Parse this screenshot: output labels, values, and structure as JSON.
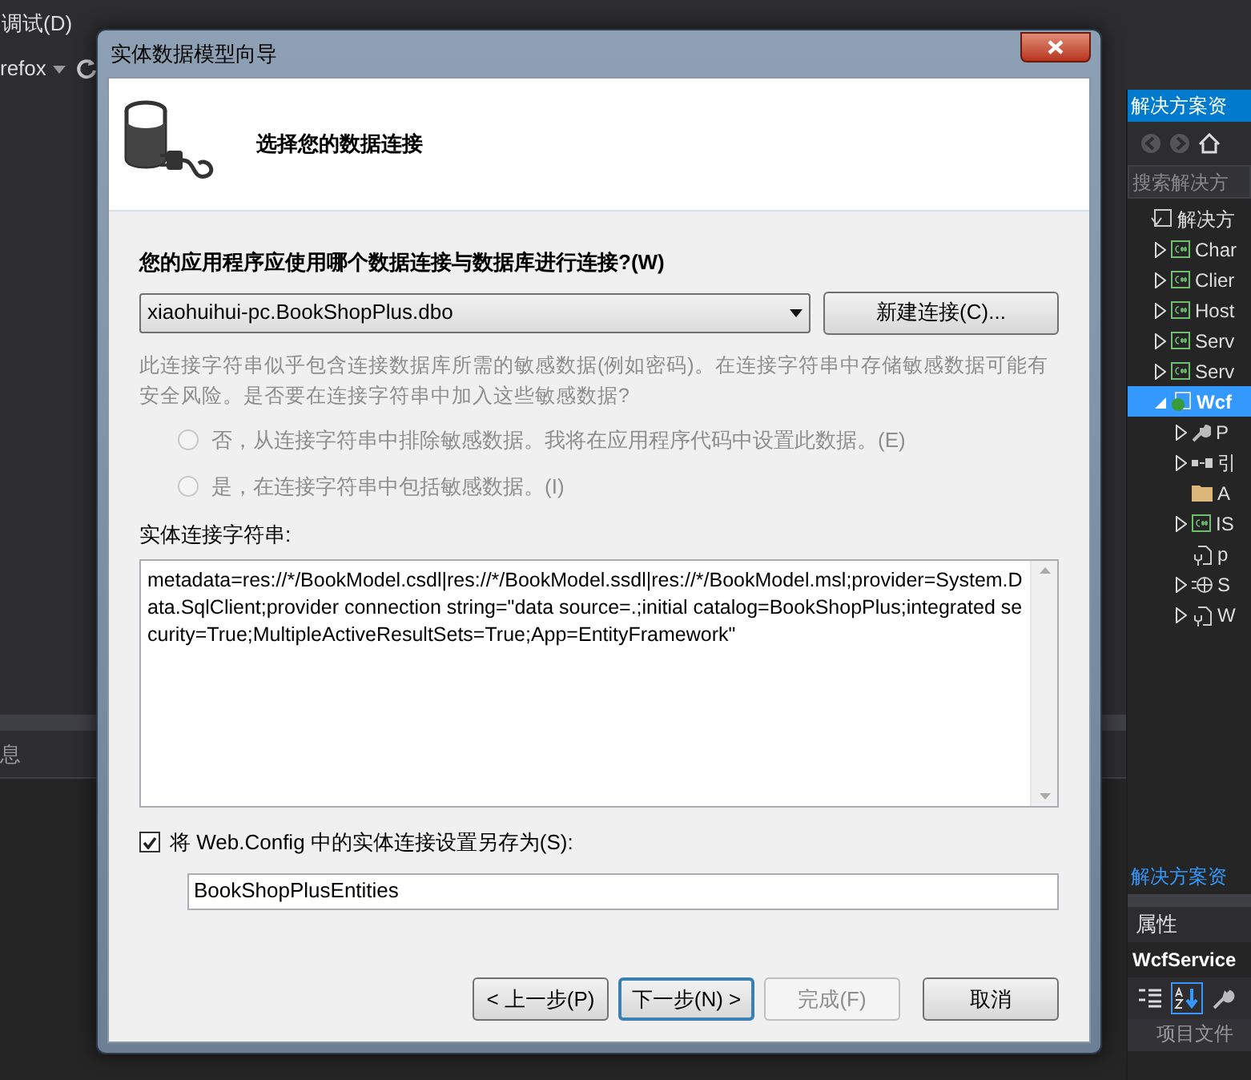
{
  "menu_bar": [
    "调试(D)"
  ],
  "toolbar": {
    "browser": "refox"
  },
  "output_panel": {
    "title": "息"
  },
  "solution_explorer": {
    "title": "解决方案资",
    "search": {
      "placeholder": "搜索解决方"
    },
    "tree": {
      "label": "解决方",
      "kind": "solution",
      "expandable": false,
      "selected": false,
      "children": [
        {
          "label": "Char",
          "kind": "project",
          "expandable": true,
          "expanded": false,
          "selected": false
        },
        {
          "label": "Clier",
          "kind": "project",
          "expandable": true,
          "expanded": false,
          "selected": false
        },
        {
          "label": "Host",
          "kind": "project",
          "expandable": true,
          "expanded": false,
          "selected": false
        },
        {
          "label": "Serv",
          "kind": "project",
          "expandable": true,
          "expanded": false,
          "selected": false
        },
        {
          "label": "Serv",
          "kind": "project",
          "expandable": true,
          "expanded": false,
          "selected": false
        },
        {
          "label": "Wcf",
          "kind": "web",
          "expandable": true,
          "expanded": true,
          "selected": true,
          "children": [
            {
              "label": "P",
              "kind": "wrench",
              "expandable": true,
              "expanded": false,
              "selected": false
            },
            {
              "label": "引",
              "kind": "references",
              "expandable": true,
              "expanded": false,
              "selected": false
            },
            {
              "label": "A",
              "kind": "folder",
              "expandable": false,
              "selected": false
            },
            {
              "label": "IS",
              "kind": "csfile",
              "expandable": true,
              "expanded": false,
              "selected": false
            },
            {
              "label": "p",
              "kind": "config",
              "expandable": false,
              "selected": false
            },
            {
              "label": "S",
              "kind": "globe",
              "expandable": true,
              "expanded": false,
              "selected": false
            },
            {
              "label": "W",
              "kind": "config",
              "expandable": true,
              "expanded": false,
              "selected": false
            }
          ]
        }
      ]
    },
    "footer_tab": "解决方案资"
  },
  "properties": {
    "title": "属性",
    "object": "WcfService",
    "tools": [
      {
        "kind": "categorized",
        "selected": false
      },
      {
        "kind": "alphabetical",
        "selected": true
      },
      {
        "kind": "wrench",
        "selected": false
      }
    ],
    "row": "项目文件"
  },
  "dialog": {
    "title": "实体数据模型向导",
    "heading": "选择您的数据连接",
    "question": "您的应用程序应使用哪个数据连接与数据库进行连接?(W)",
    "connection": {
      "value": "xiaohuihui-pc.BookShopPlus.dbo"
    },
    "new_connection_button": "新建连接(C)...",
    "warning": {
      "text": "此连接字符串似乎包含连接数据库所需的敏感数据(例如密码)。在连接字符串中存储敏感数据可能有安全风险。是否要在连接字符串中加入这些敏感数据?",
      "disabled": true
    },
    "options": [
      {
        "label": "否，从连接字符串中排除敏感数据。我将在应用程序代码中设置此数据。(E)",
        "selected": false,
        "disabled": true
      },
      {
        "label": "是，在连接字符串中包括敏感数据。(I)",
        "selected": false,
        "disabled": true
      }
    ],
    "connection_string_label": "实体连接字符串:",
    "connection_string": "metadata=res://*/BookModel.csdl|res://*/BookModel.ssdl|res://*/BookModel.msl;provider=System.Data.SqlClient;provider connection string=\"data source=.;initial catalog=BookShopPlus;integrated security=True;MultipleActiveResultSets=True;App=EntityFramework\"",
    "save_setting": {
      "label": "将 Web.Config 中的实体连接设置另存为(S):",
      "checked": true
    },
    "entities_name": "BookShopPlusEntities",
    "buttons": [
      {
        "label": "< 上一步(P)",
        "disabled": false,
        "default": false
      },
      {
        "label": "下一步(N) >",
        "disabled": false,
        "default": true
      },
      {
        "label": "完成(F)",
        "disabled": true,
        "default": false
      },
      {
        "label": "取消",
        "disabled": false,
        "default": false
      }
    ]
  }
}
